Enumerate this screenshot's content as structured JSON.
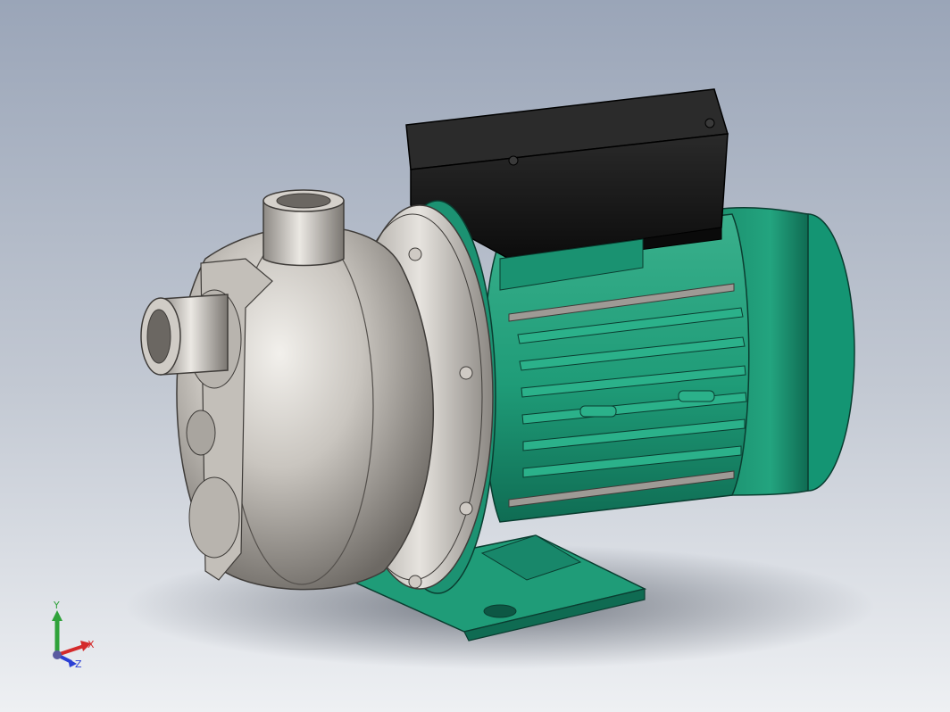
{
  "triad": {
    "x_label": "X",
    "y_label": "Y",
    "z_label": "Z"
  },
  "colors": {
    "background_top": "#9aa5b8",
    "background_bottom": "#eef0f3",
    "motor_green": "#1f9c78",
    "motor_dark": "#107156",
    "steel_light": "#d8d4cf",
    "steel_dark": "#6e6a66",
    "terminal_box": "#161616",
    "axis_x": "#d42a2a",
    "axis_y": "#2fa23a",
    "axis_z": "#2a3fd4"
  }
}
